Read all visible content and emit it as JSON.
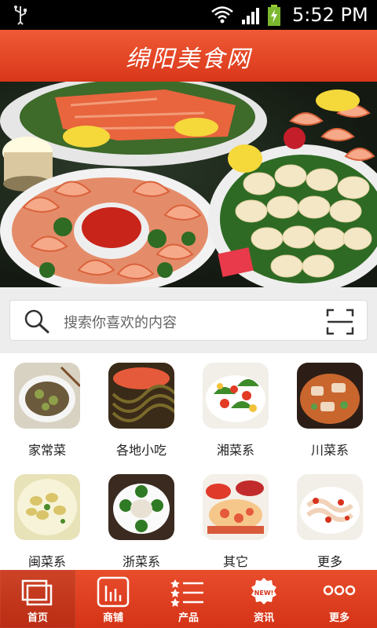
{
  "status_bar": {
    "time": "5:52 PM"
  },
  "header": {
    "title": "绵阳美食网"
  },
  "banner": {
    "slide_count": 5,
    "active_index": 0
  },
  "search": {
    "placeholder": "搜索你喜欢的内容"
  },
  "categories": [
    {
      "label": "家常菜",
      "icon": "home-dish-photo"
    },
    {
      "label": "各地小吃",
      "icon": "snack-photo"
    },
    {
      "label": "湘菜系",
      "icon": "hunan-dish-photo"
    },
    {
      "label": "川菜系",
      "icon": "sichuan-dish-photo"
    },
    {
      "label": "闽菜系",
      "icon": "fujian-dish-photo"
    },
    {
      "label": "浙菜系",
      "icon": "zhejiang-dish-photo"
    },
    {
      "label": "其它",
      "icon": "other-dish-photo"
    },
    {
      "label": "更多",
      "icon": "more-dish-photo"
    }
  ],
  "tabs": [
    {
      "label": "首页",
      "icon": "home-icon"
    },
    {
      "label": "商铺",
      "icon": "shop-icon"
    },
    {
      "label": "产品",
      "icon": "product-list-icon"
    },
    {
      "label": "资讯",
      "icon": "news-badge-icon",
      "badge": "NEW!"
    },
    {
      "label": "更多",
      "icon": "more-icon"
    }
  ],
  "colors": {
    "brand": "#e2401f",
    "header_top": "#f05a35"
  }
}
